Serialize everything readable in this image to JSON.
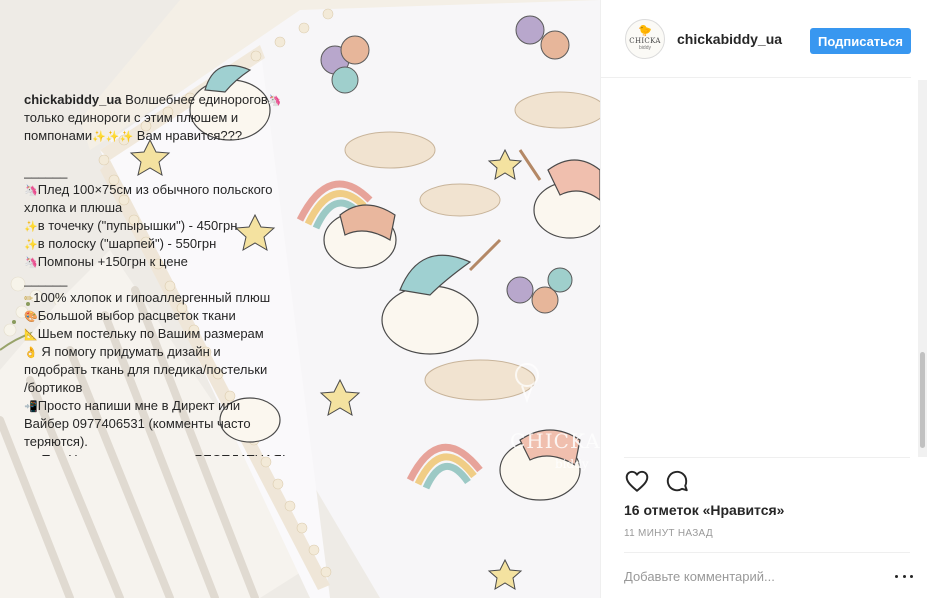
{
  "post": {
    "username": "chickabiddy_ua",
    "follow_label": "Подписаться",
    "avatar": {
      "brand_text": "CHICKA",
      "sub_text": "biddy",
      "icon": "chick-icon"
    },
    "watermark": {
      "brand_text": "CHICKA",
      "sub_text": "biddy"
    },
    "caption": {
      "owner": "chickabiddy_ua",
      "first_line_text": "Волшебнее единорогов",
      "lines": [
        {
          "emoji": "",
          "text": "только единороги с этим плюшем и"
        },
        {
          "emoji": "",
          "text": "помпонами",
          "trail": "✨✨✨",
          "tail": " Вам нравится???"
        },
        {
          "emoji": "",
          "text": ""
        },
        {
          "emoji": "",
          "text": "______"
        },
        {
          "emoji": "🦄",
          "text": "Плед 100×75см из обычного польского"
        },
        {
          "emoji": "",
          "text": "хлопка и плюша"
        },
        {
          "emoji": "✨",
          "text": "в точечку (\"пупырышки\") - 450грн"
        },
        {
          "emoji": "✨",
          "text": "в полоску (\"шарпей\") - 550грн"
        },
        {
          "emoji": "🦄",
          "text": "Помпоны +150грн к цене"
        },
        {
          "emoji": "",
          "text": "______"
        },
        {
          "emoji": "✏",
          "text": "100% хлопок и гипоаллергенный плюш"
        },
        {
          "emoji": "🎨",
          "text": "Большой выбор расцветок ткани"
        },
        {
          "emoji": "📐",
          "text": "Шьем постельку по Вашим размерам"
        },
        {
          "emoji": "👌",
          "text": " Я помогу придумать дизайн и"
        },
        {
          "emoji": "",
          "text": "подобрать ткань для пледика/постельки"
        },
        {
          "emoji": "",
          "text": "/бортиков"
        },
        {
          "emoji": "📲",
          "text": "Просто напиши мне в Директ или"
        },
        {
          "emoji": "",
          "text": "Вайбер 0977406531 (комменты часто"
        },
        {
          "emoji": "",
          "text": "теряются)."
        },
        {
          "emoji": "🚚",
          "text": " По г.Николаеву доставка БЕСПЛАТНАЯ!"
        }
      ],
      "first_emoji": "🦄"
    },
    "likes_text": "16 отметок «Нравится»",
    "time_text": "11 МИНУТ НАЗАД",
    "comment_placeholder": "Добавьте комментарий...",
    "icons": {
      "like": "heart-icon",
      "comment": "comment-icon",
      "more": "more-options-icon"
    },
    "colors": {
      "accent": "#3897f0",
      "text": "#262626",
      "muted": "#999999"
    }
  }
}
